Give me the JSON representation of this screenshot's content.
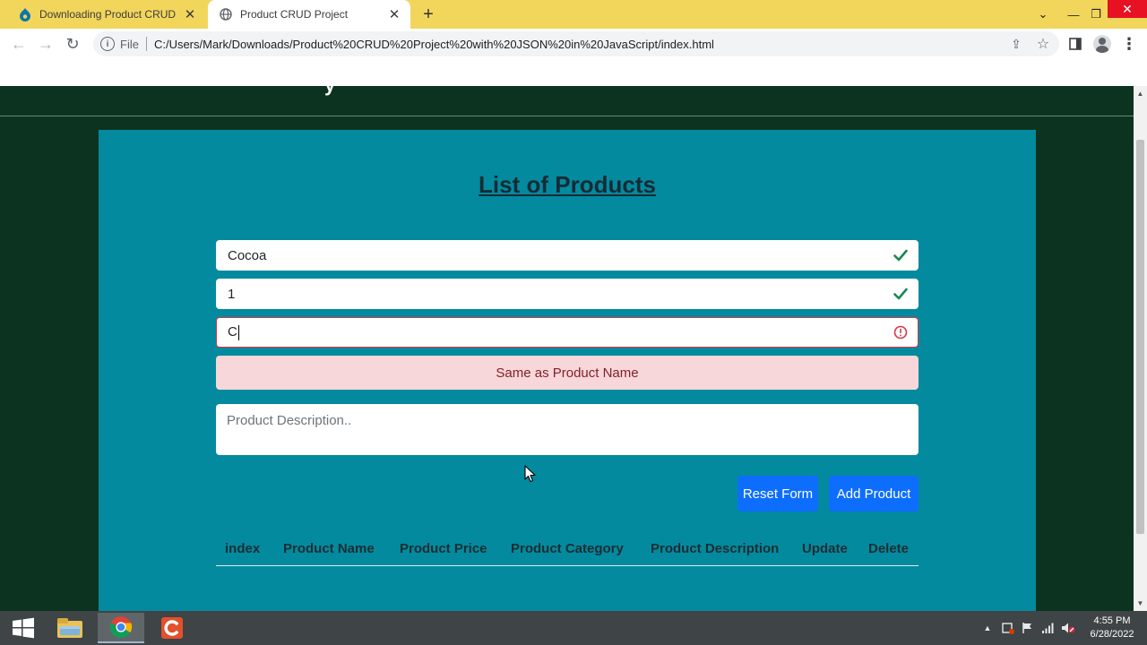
{
  "browser": {
    "tabs": [
      {
        "title": "Downloading Product CRUD Proj",
        "icon": "drupal-icon",
        "active": false
      },
      {
        "title": "Product CRUD Project",
        "icon": "globe-icon",
        "active": true
      }
    ],
    "address": {
      "scheme_label": "File",
      "url": "C:/Users/Mark/Downloads/Product%20CRUD%20Project%20with%20JSON%20in%20JavaScript/index.html"
    }
  },
  "page": {
    "header_remnant": "y",
    "title": "List of Products",
    "form": {
      "product_name": {
        "value": "Cocoa",
        "state": "valid"
      },
      "product_price": {
        "value": "1",
        "state": "valid"
      },
      "product_category": {
        "value": "C",
        "state": "invalid"
      },
      "category_alert": "Same as Product Name",
      "description": {
        "value": "",
        "placeholder": "Product Description.."
      }
    },
    "buttons": {
      "reset": "Reset Form",
      "add": "Add Product"
    },
    "table": {
      "headers": [
        "index",
        "Product Name",
        "Product Price",
        "Product Category",
        "Product Description",
        "Update",
        "Delete"
      ],
      "rows": []
    }
  },
  "taskbar": {
    "apps": [
      "file-explorer-icon",
      "chrome-icon",
      "camtasia-icon"
    ],
    "clock": {
      "time": "4:55 PM",
      "date": "6/28/2022"
    }
  },
  "colors": {
    "tabstrip": "#f2d65c",
    "page_background": "#0b3320",
    "panel": "#038a9e",
    "title_text": "#172b35",
    "valid_check": "#198754",
    "invalid_icon": "#dc3545",
    "alert_bg": "#f8d7da",
    "alert_text": "#842029",
    "button": "#0d6efd"
  }
}
